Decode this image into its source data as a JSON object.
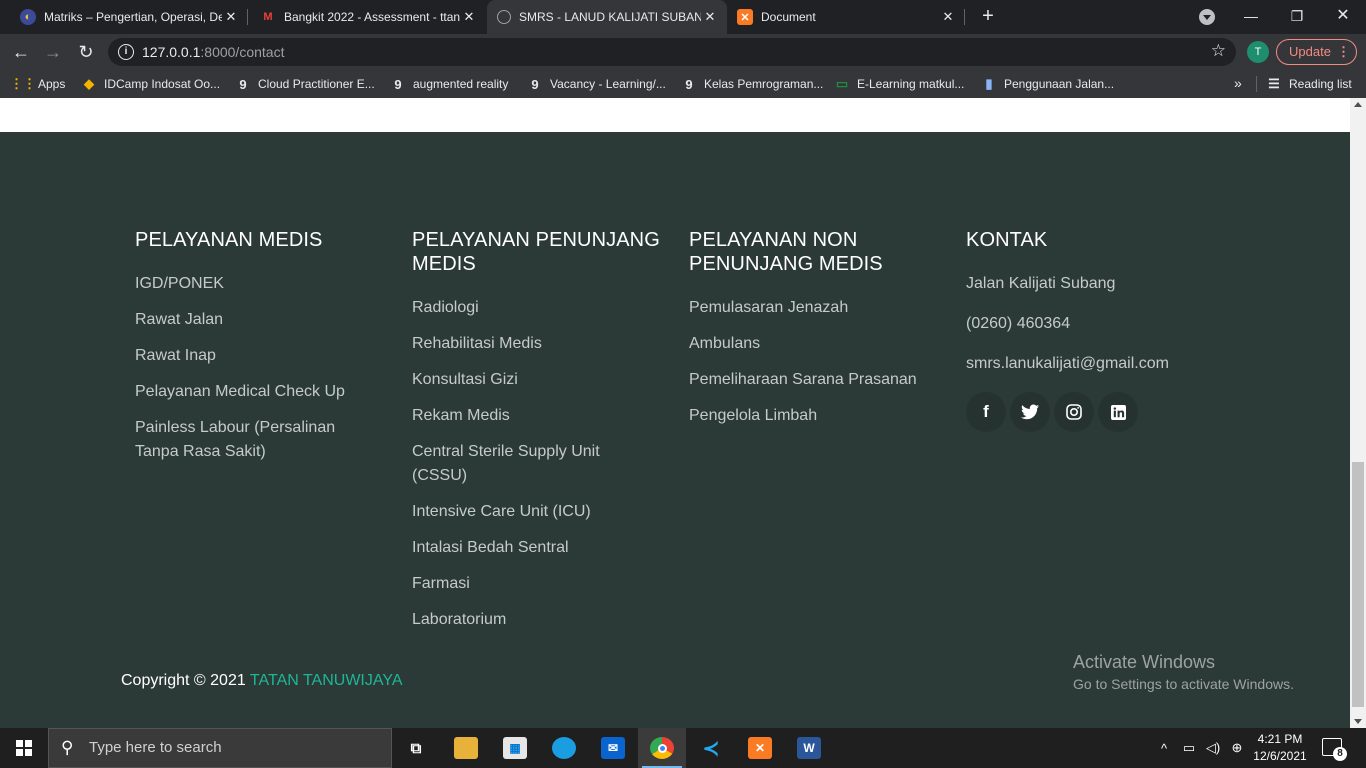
{
  "browser": {
    "tabs": [
      {
        "title": "Matriks – Pengertian, Operasi, De",
        "icon": "quiz-favicon-icon",
        "active": false
      },
      {
        "title": "Bangkit 2022 - Assessment - ttan",
        "icon": "gmail-icon",
        "active": false
      },
      {
        "title": "SMRS - LANUD KALIJATI SUBANG",
        "icon": "globe-icon",
        "active": true
      },
      {
        "title": "Document",
        "icon": "xampp-icon",
        "active": false
      }
    ],
    "address": {
      "host": "127.0.0.1",
      "path": ":8000/contact"
    },
    "profile_initial": "T",
    "update_label": "Update",
    "bookmarks": [
      {
        "label": "Apps",
        "icon": "apps-grid-icon"
      },
      {
        "label": "IDCamp Indosat Oo...",
        "icon": "idcamp-icon"
      },
      {
        "label": "Cloud Practitioner E...",
        "icon": "dicoding-icon"
      },
      {
        "label": "augmented reality",
        "icon": "dicoding-icon"
      },
      {
        "label": "Vacancy - Learning/...",
        "icon": "dicoding-icon"
      },
      {
        "label": "Kelas Pemrograman...",
        "icon": "dicoding-icon"
      },
      {
        "label": "E-Learning matkul...",
        "icon": "classroom-icon"
      },
      {
        "label": "Penggunaan Jalan...",
        "icon": "document-icon"
      }
    ],
    "reading_list": "Reading list"
  },
  "footer": {
    "columns": [
      {
        "heading": "PELAYANAN MEDIS",
        "links": [
          "IGD/PONEK",
          "Rawat Jalan",
          "Rawat Inap",
          "Pelayanan Medical Check Up",
          "Painless Labour (Persalinan Tanpa Rasa Sakit)"
        ]
      },
      {
        "heading": "PELAYANAN PENUNJANG MEDIS",
        "links": [
          "Radiologi",
          "Rehabilitasi Medis",
          "Konsultasi Gizi",
          "Rekam Medis",
          "Central Sterile Supply Unit (CSSU)",
          "Intensive Care Unit (ICU)",
          "Intalasi Bedah Sentral",
          "Farmasi",
          "Laboratorium"
        ]
      },
      {
        "heading": "PELAYANAN NON PENUNJANG MEDIS",
        "links": [
          "Pemulasaran Jenazah",
          "Ambulans",
          "Pemeliharaan Sarana Prasanan",
          "Pengelola Limbah"
        ]
      }
    ],
    "contact": {
      "heading": "KONTAK",
      "address": "Jalan Kalijati Subang",
      "phone": "(0260) 460364",
      "email": "smrs.lanukalijati@gmail.com",
      "socials": [
        "facebook-icon",
        "twitter-icon",
        "instagram-icon",
        "linkedin-icon"
      ]
    },
    "copyright_prefix": "Copyright © 2021 ",
    "copyright_brand": "TATAN TANUWIJAYA",
    "accent": "#1fb597",
    "background": "#2c3a37"
  },
  "watermark": {
    "line1": "Activate Windows",
    "line2": "Go to Settings to activate Windows."
  },
  "taskbar": {
    "search_placeholder": "Type here to search",
    "time": "4:21 PM",
    "date": "12/6/2021",
    "notifications": "8"
  }
}
